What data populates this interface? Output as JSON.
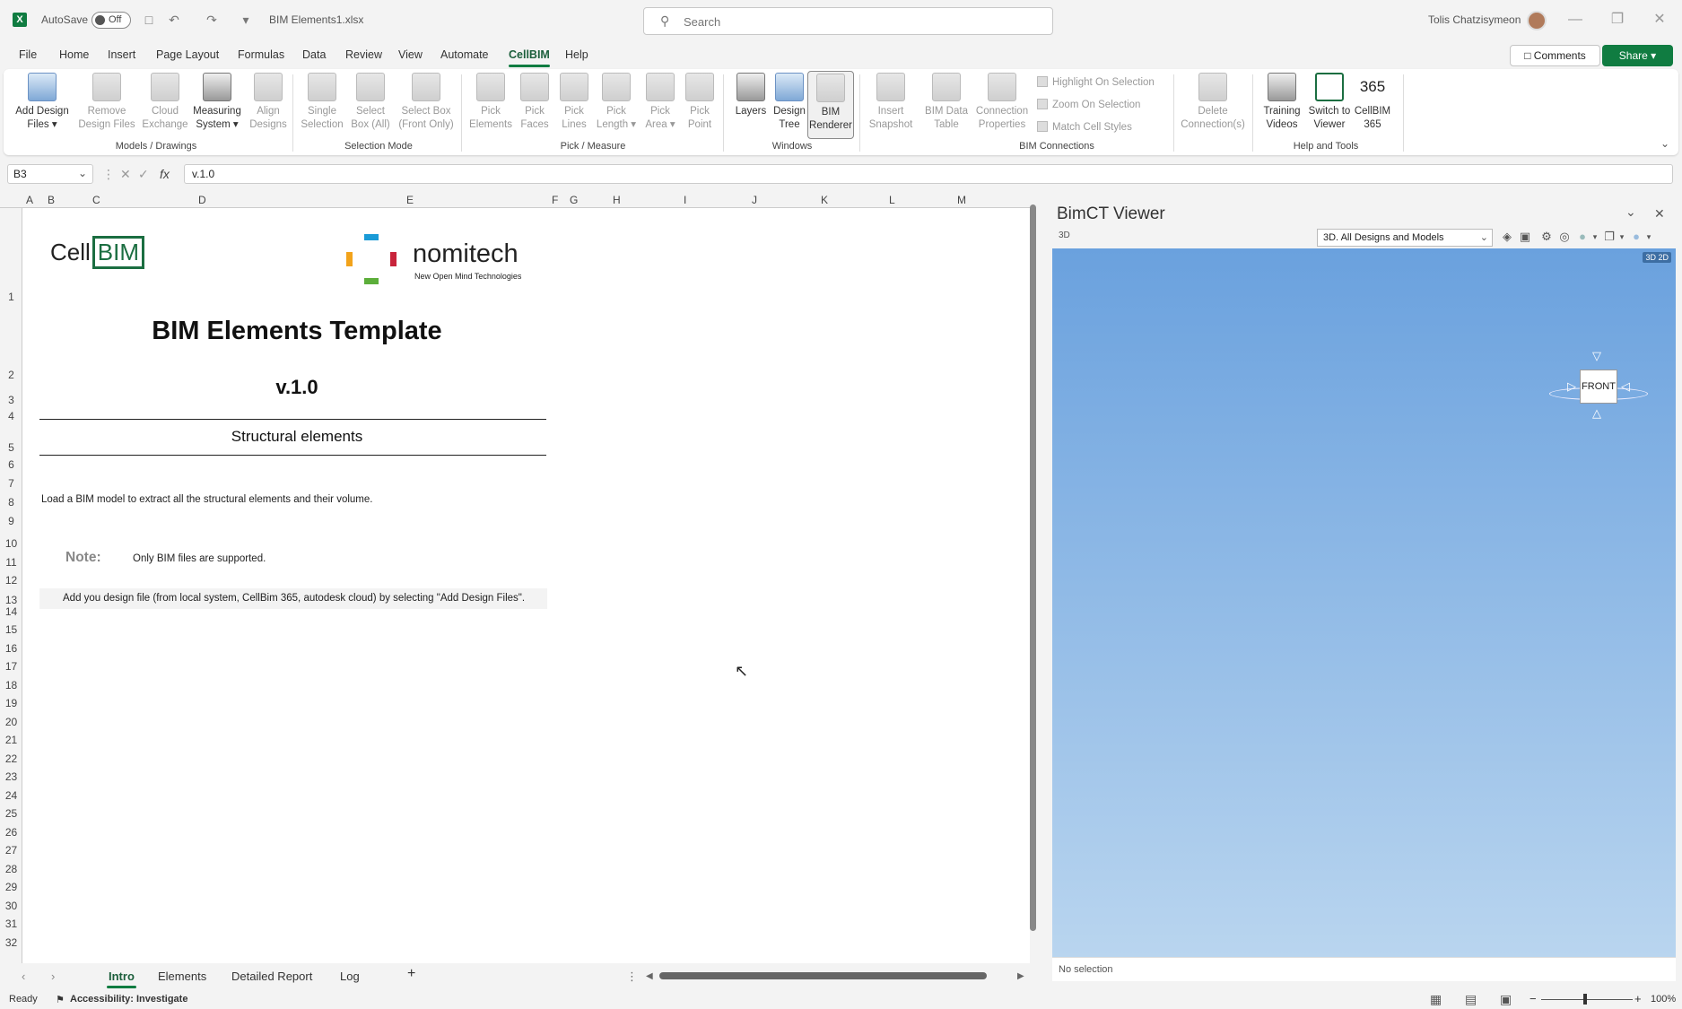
{
  "titlebar": {
    "autosave_label": "AutoSave",
    "autosave_state": "Off",
    "filename": "BIM Elements1.xlsx",
    "search_placeholder": "Search",
    "user_name": "Tolis Chatzisymeon"
  },
  "menu": {
    "tabs": [
      "File",
      "Home",
      "Insert",
      "Page Layout",
      "Formulas",
      "Data",
      "Review",
      "View",
      "Automate",
      "CellBIM",
      "Help"
    ],
    "active_tab": "CellBIM",
    "comments_label": "Comments",
    "share_label": "Share"
  },
  "ribbon": {
    "models": {
      "add_design_files": "Add Design Files",
      "remove_design_files": "Remove Design Files",
      "cloud_exchange": "Cloud Exchange",
      "measuring_system": "Measuring System",
      "align_designs": "Align Designs",
      "group": "Models / Drawings"
    },
    "selection": {
      "single_selection": "Single Selection",
      "select_box_all": "Select Box (All)",
      "select_box_front": "Select Box (Front Only)",
      "group": "Selection Mode"
    },
    "pick": {
      "pick_elements": "Pick Elements",
      "pick_faces": "Pick Faces",
      "pick_lines": "Pick Lines",
      "pick_length": "Pick Length",
      "pick_area": "Pick Area",
      "pick_point": "Pick Point",
      "group": "Pick / Measure"
    },
    "windows": {
      "layers": "Layers",
      "design_tree": "Design Tree",
      "bim_renderer": "BIM Renderer",
      "group": "Windows"
    },
    "connections": {
      "insert_snapshot": "Insert Snapshot",
      "bim_data_table": "BIM Data Table",
      "connection_properties": "Connection Properties",
      "highlight_on_selection": "Highlight On Selection",
      "zoom_on_selection": "Zoom On Selection",
      "match_cell_styles": "Match Cell Styles",
      "delete_connections": "Delete Connection(s)",
      "group": "BIM Connections"
    },
    "help": {
      "training_videos": "Training Videos",
      "switch_to_viewer": "Switch to Viewer",
      "cellbim_365": "CellBIM 365",
      "group": "Help and Tools"
    }
  },
  "formula_bar": {
    "name_box": "B3",
    "formula": "v.1.0"
  },
  "grid": {
    "columns": [
      "A",
      "B",
      "C",
      "D",
      "E",
      "F",
      "G",
      "H",
      "I",
      "J",
      "K",
      "L",
      "M"
    ],
    "rows": [
      "1",
      "2",
      "3",
      "4",
      "5",
      "6",
      "7",
      "8",
      "9",
      "10",
      "11",
      "12",
      "13",
      "14",
      "15",
      "16",
      "17",
      "18",
      "19",
      "20",
      "21",
      "22",
      "23",
      "24",
      "25",
      "26",
      "27",
      "28",
      "29",
      "30",
      "31",
      "32"
    ]
  },
  "sheet": {
    "logo_cell": "Cell",
    "logo_bim": "BIM",
    "logo_nomitech": "nomitech",
    "logo_nomitech_sub": "New Open Mind Technologies",
    "title": "BIM Elements Template",
    "version": "v.1.0",
    "section": "Structural elements",
    "description": "Load a BIM model to extract all the structural elements and their volume.",
    "note_label": "Note:",
    "note_text": "Only BIM files are supported.",
    "add_instruction": "Add you design file (from local system, CellBim 365, autodesk cloud) by selecting \"Add Design Files\"."
  },
  "sheet_tabs": {
    "tabs": [
      "Intro",
      "Elements",
      "Detailed Report",
      "Log"
    ],
    "active": "Intro"
  },
  "status_bar": {
    "ready": "Ready",
    "accessibility": "Accessibility: Investigate",
    "zoom": "100%"
  },
  "viewer": {
    "title": "BimCT Viewer",
    "mode_label": "3D",
    "view_select": "3D. All Designs and Models",
    "badge": "3D 2D",
    "cube_face": "FRONT",
    "selection_status": "No selection"
  },
  "colors": {
    "excel_green": "#107c41",
    "viewer_top": "#6aa1de",
    "viewer_bottom": "#b9d5ef"
  }
}
